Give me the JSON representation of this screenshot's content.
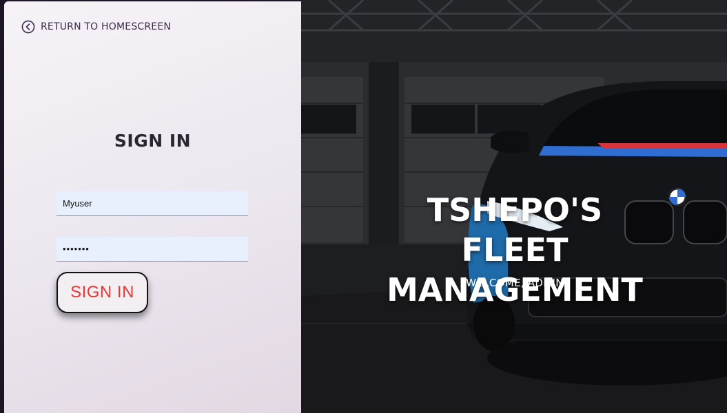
{
  "login": {
    "return_label": "RETURN TO HOMESCREEN",
    "title": "SIGN IN",
    "username_value": "Myuser",
    "password_value": "•••••••",
    "submit_label": "SIGN IN"
  },
  "hero": {
    "title": "TSHEPO'S FLEET MANAGEMENT",
    "subtitle": "WELCOME, ADMIN"
  },
  "icons": {
    "return": "chevron-left-circle-icon",
    "car_logo": "bmw-logo-icon"
  },
  "colors": {
    "button_text": "#e53935",
    "input_bg": "#e8f0fe",
    "panel_text": "#3d2b49",
    "car_stripe_blue": "#2f6dd0",
    "car_stripe_red": "#d9343b"
  }
}
